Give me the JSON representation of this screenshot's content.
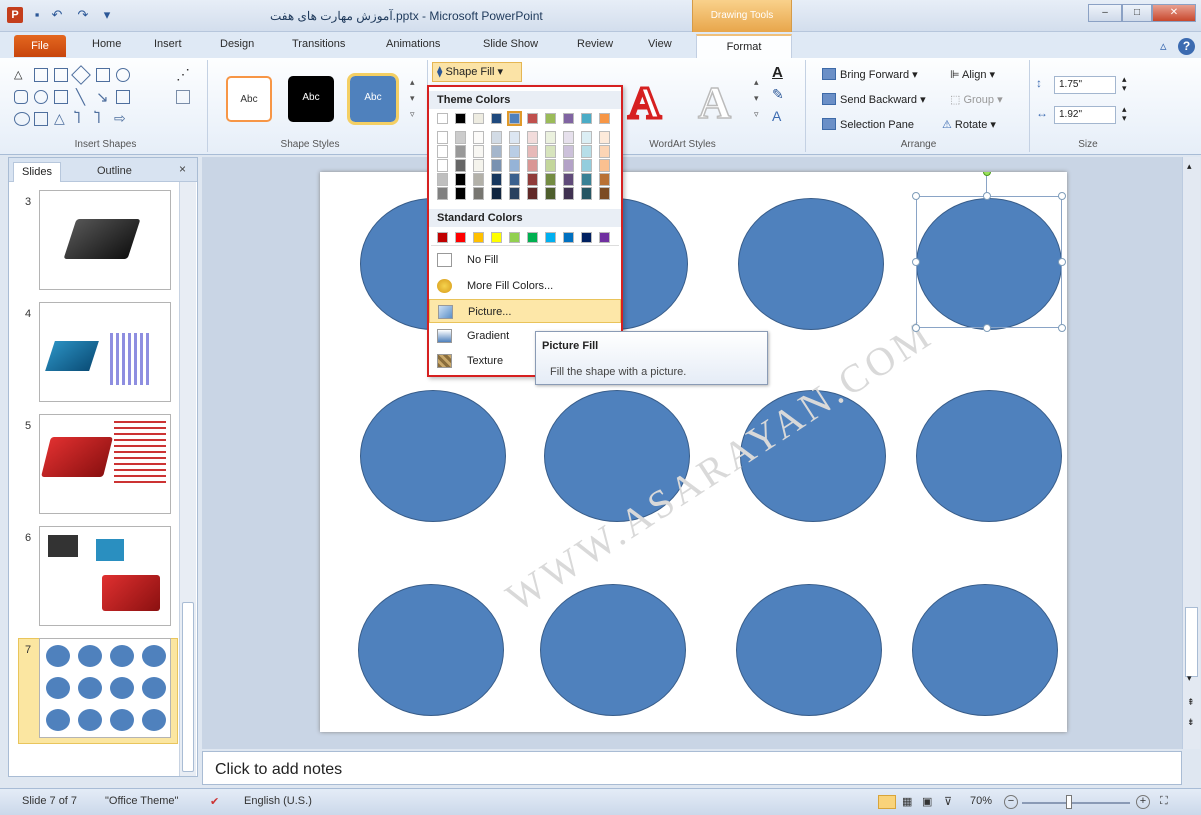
{
  "window": {
    "title": "آموزش مهارت های هفت.pptx - Microsoft PowerPoint",
    "context_tab": "Drawing Tools",
    "app_icon": "P"
  },
  "tabs": [
    "Home",
    "Insert",
    "Design",
    "Transitions",
    "Animations",
    "Slide Show",
    "Review",
    "View"
  ],
  "file_tab": "File",
  "format_tab": "Format",
  "ribbon": {
    "groups": {
      "insert_shapes": "Insert Shapes",
      "shape_styles": "Shape Styles",
      "wordart_styles": "WordArt Styles",
      "arrange": "Arrange",
      "size": "Size"
    },
    "abc": "Abc",
    "shape_fill": "Shape Fill",
    "bring_forward": "Bring Forward",
    "send_backward": "Send Backward",
    "selection_pane": "Selection Pane",
    "align": "Align",
    "group": "Group",
    "rotate": "Rotate",
    "height": "1.75\"",
    "width": "1.92\""
  },
  "dropdown": {
    "theme_colors": "Theme Colors",
    "standard_colors": "Standard Colors",
    "no_fill": "No Fill",
    "more_fill_colors": "More Fill Colors...",
    "picture": "Picture...",
    "gradient": "Gradient",
    "texture": "Texture",
    "theme_top": [
      "#ffffff",
      "#000000",
      "#eeece1",
      "#1f497d",
      "#4f81bd",
      "#c0504d",
      "#9bbb59",
      "#8064a2",
      "#4bacc6",
      "#f79646"
    ],
    "standard": [
      "#c00000",
      "#ff0000",
      "#ffc000",
      "#ffff00",
      "#92d050",
      "#00b050",
      "#00b0f0",
      "#0070c0",
      "#002060",
      "#7030a0"
    ]
  },
  "tooltip": {
    "title": "Picture Fill",
    "body": "Fill the shape with a picture."
  },
  "slides_pane": {
    "tab_slides": "Slides",
    "tab_outline": "Outline",
    "close": "×",
    "numbers": [
      "3",
      "4",
      "5",
      "6",
      "7"
    ]
  },
  "watermark": "WWW.ASARAYAN.COM",
  "notes": {
    "placeholder": "Click to add notes"
  },
  "status": {
    "slide": "Slide 7 of 7",
    "theme": "\"Office Theme\"",
    "language": "English (U.S.)",
    "zoom": "70%"
  },
  "colors": {
    "accent": "#4f81bd",
    "file_tab": "#c7450c",
    "context_tab": "#e8a64b",
    "highlight_border": "#d62020"
  }
}
